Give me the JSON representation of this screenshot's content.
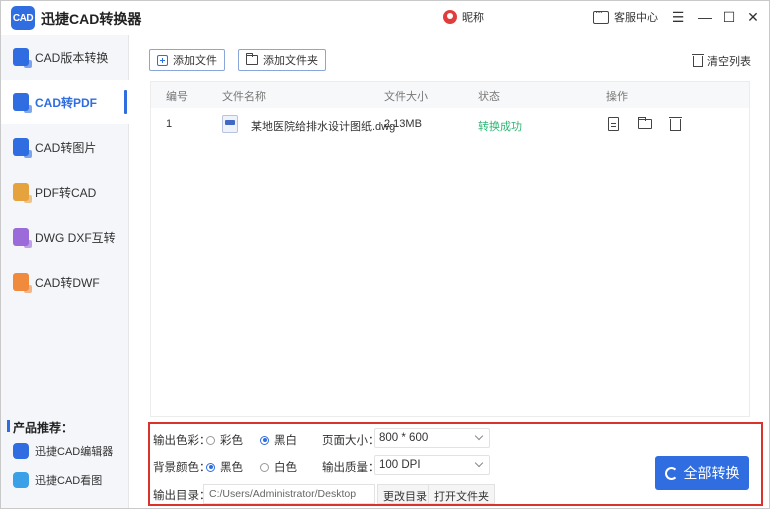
{
  "app": {
    "logo_text": "CAD",
    "title": "迅捷CAD转换器"
  },
  "header": {
    "user_name": "昵称",
    "service_label": "客服中心"
  },
  "window_controls": {
    "menu": "☰",
    "minimize": "—",
    "maximize": "☐",
    "close": "✕"
  },
  "sidebar": {
    "items": [
      {
        "label": "CAD版本转换",
        "icon": "cad-version-icon",
        "color": "#2f6de1",
        "active": false
      },
      {
        "label": "CAD转PDF",
        "icon": "cad-pdf-icon",
        "color": "#2f6de1",
        "active": true
      },
      {
        "label": "CAD转图片",
        "icon": "cad-image-icon",
        "color": "#2f6de1",
        "active": false
      },
      {
        "label": "PDF转CAD",
        "icon": "pdf-cad-icon",
        "color": "#e6a23c",
        "active": false
      },
      {
        "label": "DWG DXF互转",
        "icon": "dwg-dxf-icon",
        "color": "#9b6bd9",
        "active": false
      },
      {
        "label": "CAD转DWF",
        "icon": "cad-dwf-icon",
        "color": "#f08a3c",
        "active": false
      }
    ],
    "recommend_title": "产品推荐：",
    "recommend": [
      {
        "label": "迅捷CAD编辑器"
      },
      {
        "label": "迅捷CAD看图"
      }
    ]
  },
  "toolbar": {
    "add_file": "添加文件",
    "add_folder": "添加文件夹",
    "clear_list": "清空列表"
  },
  "table": {
    "headers": [
      "编号",
      "文件名称",
      "文件大小",
      "状态",
      "操作"
    ],
    "rows": [
      {
        "index": "1",
        "name": "某地医院给排水设计图纸.dwg",
        "size": "2.13MB",
        "status": "转换成功"
      }
    ]
  },
  "settings": {
    "color_label": "输出色彩：",
    "color_options": [
      "彩色",
      "黑白"
    ],
    "color_selected": "黑白",
    "page_size_label": "页面大小：",
    "page_size_value": "800 * 600",
    "bg_label": "背景颜色：",
    "bg_options": [
      "黑色",
      "白色"
    ],
    "bg_selected": "黑色",
    "quality_label": "输出质量：",
    "quality_value": "100 DPI",
    "dir_label": "输出目录：",
    "dir_value": "C:/Users/Administrator/Desktop",
    "change_dir": "更改目录",
    "open_folder": "打开文件夹",
    "convert_all": "全部转换"
  },
  "colors": {
    "accent": "#2f6de1",
    "success": "#2bb673",
    "highlight_border": "#d9332b"
  }
}
